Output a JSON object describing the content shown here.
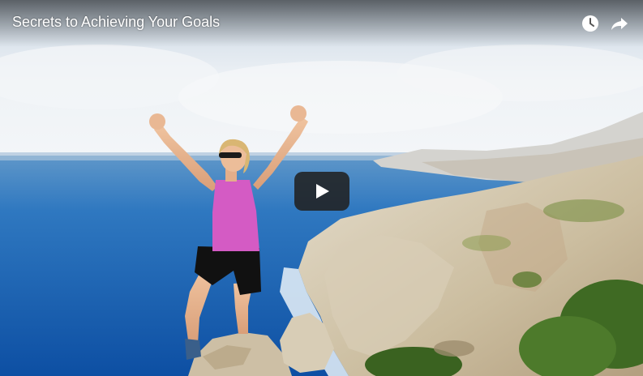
{
  "video": {
    "title": "Secrets to Achieving Your Goals"
  },
  "controls": {
    "watch_later_icon": "clock-icon",
    "share_icon": "share-arrow-icon",
    "play_icon": "play-icon"
  },
  "colors": {
    "sky": "#dfe9f2",
    "sea": "#1f66b3",
    "cliff": "#cfc3a8",
    "shirt": "#d45bc4",
    "play_button": "#212121"
  }
}
